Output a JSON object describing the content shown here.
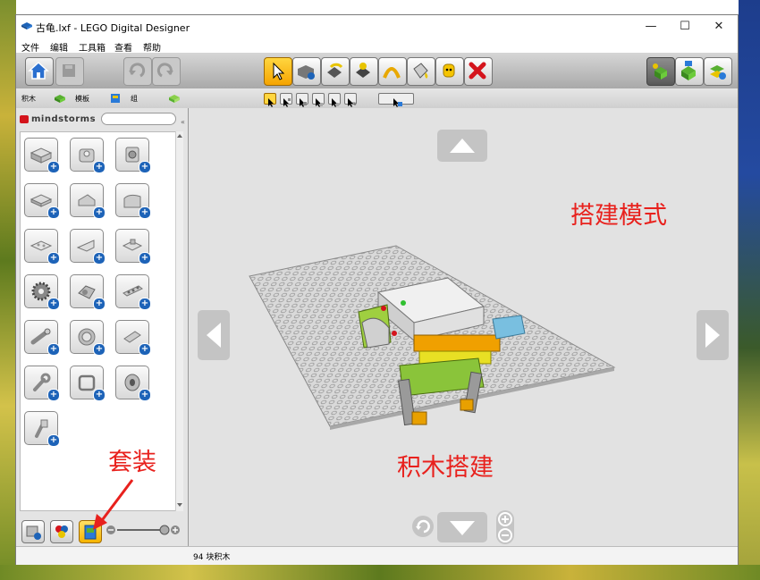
{
  "window": {
    "title": "古龟.lxf - LEGO Digital Designer"
  },
  "window_controls": {
    "minimize": "—",
    "maximize": "☐",
    "close": "✕"
  },
  "menu": [
    "文件",
    "编辑",
    "工具箱",
    "查看",
    "帮助"
  ],
  "tabs": [
    "积木",
    "模板",
    "组"
  ],
  "palette": {
    "brand": "mindstorms",
    "search_placeholder": ""
  },
  "status": {
    "brick_count": "94 块积木"
  },
  "annotations": {
    "build_mode": "搭建模式",
    "brick_build": "积木搭建",
    "kits": "套装"
  },
  "colors": {
    "annotation_red": "#e8211d",
    "selected_tool": "#f5b400",
    "badge_blue": "#1d63b8"
  }
}
